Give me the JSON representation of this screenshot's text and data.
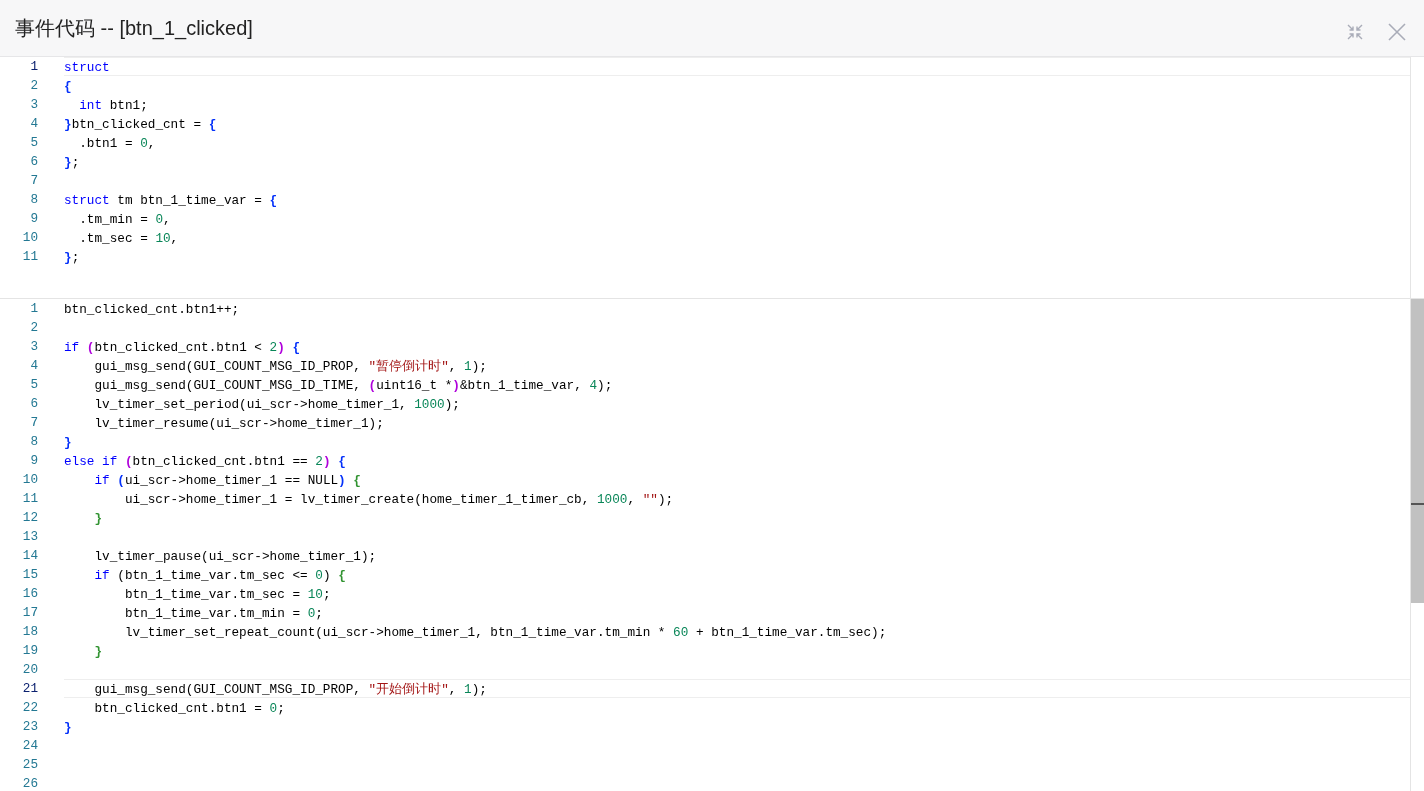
{
  "dialog": {
    "title": "事件代码 -- [btn_1_clicked]"
  },
  "editors": [
    {
      "lines": [
        {
          "num": "1",
          "current": true,
          "tokens": [
            {
              "kind": "keyword",
              "text": "struct"
            }
          ]
        },
        {
          "num": "2",
          "current": false,
          "tokens": [
            {
              "kind": "bracket",
              "text": "{",
              "color": "#0431fa"
            }
          ]
        },
        {
          "num": "3",
          "current": false,
          "tokens": [
            {
              "kind": "keyword",
              "text": "  int"
            },
            {
              "kind": "plain",
              "text": " btn1;"
            }
          ]
        },
        {
          "num": "4",
          "current": false,
          "tokens": [
            {
              "kind": "bracket",
              "text": "}",
              "color": "#0431fa"
            },
            {
              "kind": "plain",
              "text": "btn_clicked_cnt = "
            },
            {
              "kind": "bracket",
              "text": "{",
              "color": "#0431fa"
            }
          ]
        },
        {
          "num": "5",
          "current": false,
          "tokens": [
            {
              "kind": "plain",
              "text": "  .btn1 = "
            },
            {
              "kind": "number",
              "text": "0"
            },
            {
              "kind": "plain",
              "text": ","
            }
          ]
        },
        {
          "num": "6",
          "current": false,
          "tokens": [
            {
              "kind": "bracket",
              "text": "}",
              "color": "#0431fa"
            },
            {
              "kind": "plain",
              "text": ";"
            }
          ]
        },
        {
          "num": "7",
          "current": false
        },
        {
          "num": "8",
          "current": false,
          "tokens": [
            {
              "kind": "keyword",
              "text": "struct"
            },
            {
              "kind": "plain",
              "text": " tm btn_1_time_var = "
            },
            {
              "kind": "bracket",
              "text": "{",
              "color": "#0431fa"
            }
          ]
        },
        {
          "num": "9",
          "current": false,
          "tokens": [
            {
              "kind": "plain",
              "text": "  .tm_min = "
            },
            {
              "kind": "number",
              "text": "0"
            },
            {
              "kind": "plain",
              "text": ","
            }
          ]
        },
        {
          "num": "10",
          "current": false,
          "tokens": [
            {
              "kind": "plain",
              "text": "  .tm_sec = "
            },
            {
              "kind": "number",
              "text": "10"
            },
            {
              "kind": "plain",
              "text": ","
            }
          ]
        },
        {
          "num": "11",
          "current": false,
          "tokens": [
            {
              "kind": "bracket",
              "text": "}",
              "color": "#0431fa"
            },
            {
              "kind": "plain",
              "text": ";"
            }
          ]
        }
      ]
    },
    {
      "lines": [
        {
          "num": "1",
          "current": false,
          "tokens": [
            {
              "kind": "plain",
              "text": "btn_clicked_cnt.btn1++;"
            }
          ]
        },
        {
          "num": "2",
          "current": false
        },
        {
          "num": "3",
          "current": false,
          "tokens": [
            {
              "kind": "keyword",
              "text": "if"
            },
            {
              "kind": "bracket",
              "text": " (",
              "color": "#af00db"
            },
            {
              "kind": "plain",
              "text": "btn_clicked_cnt.btn1 < "
            },
            {
              "kind": "number",
              "text": "2"
            },
            {
              "kind": "bracket",
              "text": ")",
              "color": "#af00db"
            },
            {
              "kind": "bracket",
              "text": " {",
              "color": "#0431fa"
            }
          ]
        },
        {
          "num": "4",
          "current": false,
          "tokens": [
            {
              "kind": "plain",
              "text": "    gui_msg_send(GUI_COUNT_MSG_ID_PROP, "
            },
            {
              "kind": "string",
              "text": "\"暂停倒计时\""
            },
            {
              "kind": "plain",
              "text": ", "
            },
            {
              "kind": "number",
              "text": "1"
            },
            {
              "kind": "plain",
              "text": ");"
            }
          ]
        },
        {
          "num": "5",
          "current": false,
          "tokens": [
            {
              "kind": "plain",
              "text": "    gui_msg_send(GUI_COUNT_MSG_ID_TIME, "
            },
            {
              "kind": "bracket",
              "text": "(",
              "color": "#af00db"
            },
            {
              "kind": "plain",
              "text": "uint16_t *"
            },
            {
              "kind": "bracket",
              "text": ")",
              "color": "#af00db"
            },
            {
              "kind": "plain",
              "text": "&btn_1_time_var, "
            },
            {
              "kind": "number",
              "text": "4"
            },
            {
              "kind": "plain",
              "text": ");"
            }
          ]
        },
        {
          "num": "6",
          "current": false,
          "tokens": [
            {
              "kind": "plain",
              "text": "    lv_timer_set_period(ui_scr->home_timer_1, "
            },
            {
              "kind": "number",
              "text": "1000"
            },
            {
              "kind": "plain",
              "text": ");"
            }
          ]
        },
        {
          "num": "7",
          "current": false,
          "tokens": [
            {
              "kind": "plain",
              "text": "    lv_timer_resume(ui_scr->home_timer_1);"
            }
          ]
        },
        {
          "num": "8",
          "current": false,
          "tokens": [
            {
              "kind": "bracket",
              "text": "}",
              "color": "#0431fa"
            }
          ]
        },
        {
          "num": "9",
          "current": false,
          "tokens": [
            {
              "kind": "keyword",
              "text": "else if"
            },
            {
              "kind": "bracket",
              "text": " (",
              "color": "#af00db"
            },
            {
              "kind": "plain",
              "text": "btn_clicked_cnt.btn1 == "
            },
            {
              "kind": "number",
              "text": "2"
            },
            {
              "kind": "bracket",
              "text": ")",
              "color": "#af00db"
            },
            {
              "kind": "bracket",
              "text": " {",
              "color": "#0431fa"
            }
          ]
        },
        {
          "num": "10",
          "current": false,
          "tokens": [
            {
              "kind": "keyword",
              "text": "    if"
            },
            {
              "kind": "bracket",
              "text": " (",
              "color": "#0431fa"
            },
            {
              "kind": "plain",
              "text": "ui_scr->home_timer_1 == NULL"
            },
            {
              "kind": "bracket",
              "text": ")",
              "color": "#0431fa"
            },
            {
              "kind": "bracket",
              "text": " {",
              "color": "#319331"
            }
          ]
        },
        {
          "num": "11",
          "current": false,
          "tokens": [
            {
              "kind": "plain",
              "text": "        ui_scr->home_timer_1 = lv_timer_create(home_timer_1_timer_cb, "
            },
            {
              "kind": "number",
              "text": "1000"
            },
            {
              "kind": "plain",
              "text": ", "
            },
            {
              "kind": "string",
              "text": "\"\""
            },
            {
              "kind": "plain",
              "text": ");"
            }
          ]
        },
        {
          "num": "12",
          "current": false,
          "tokens": [
            {
              "kind": "bracket",
              "text": "    }",
              "color": "#319331"
            }
          ]
        },
        {
          "num": "13",
          "current": false
        },
        {
          "num": "14",
          "current": false,
          "tokens": [
            {
              "kind": "plain",
              "text": "    lv_timer_pause(ui_scr->home_timer_1);"
            }
          ]
        },
        {
          "num": "15",
          "current": false,
          "tokens": [
            {
              "kind": "keyword",
              "text": "    if"
            },
            {
              "kind": "plain",
              "text": " (btn_1_time_var.tm_sec <= "
            },
            {
              "kind": "number",
              "text": "0"
            },
            {
              "kind": "plain",
              "text": ")"
            },
            {
              "kind": "bracket",
              "text": " {",
              "color": "#319331"
            }
          ]
        },
        {
          "num": "16",
          "current": false,
          "tokens": [
            {
              "kind": "plain",
              "text": "        btn_1_time_var.tm_sec = "
            },
            {
              "kind": "number",
              "text": "10"
            },
            {
              "kind": "plain",
              "text": ";"
            }
          ]
        },
        {
          "num": "17",
          "current": false,
          "tokens": [
            {
              "kind": "plain",
              "text": "        btn_1_time_var.tm_min = "
            },
            {
              "kind": "number",
              "text": "0"
            },
            {
              "kind": "plain",
              "text": ";"
            }
          ]
        },
        {
          "num": "18",
          "current": false,
          "tokens": [
            {
              "kind": "plain",
              "text": "        lv_timer_set_repeat_count(ui_scr->home_timer_1, btn_1_time_var.tm_min * "
            },
            {
              "kind": "number",
              "text": "60"
            },
            {
              "kind": "plain",
              "text": " + btn_1_time_var.tm_sec);"
            }
          ]
        },
        {
          "num": "19",
          "current": false,
          "tokens": [
            {
              "kind": "bracket",
              "text": "    }",
              "color": "#319331"
            }
          ]
        },
        {
          "num": "20",
          "current": false
        },
        {
          "num": "21",
          "current": true,
          "tokens": [
            {
              "kind": "plain",
              "text": "    gui_msg_send(GUI_COUNT_MSG_ID_PROP, "
            },
            {
              "kind": "string",
              "text": "\"开始倒计时\""
            },
            {
              "kind": "plain",
              "text": ", "
            },
            {
              "kind": "number",
              "text": "1"
            },
            {
              "kind": "plain",
              "text": ");"
            }
          ]
        },
        {
          "num": "22",
          "current": false,
          "tokens": [
            {
              "kind": "plain",
              "text": "    btn_clicked_cnt.btn1 = "
            },
            {
              "kind": "number",
              "text": "0"
            },
            {
              "kind": "plain",
              "text": ";"
            }
          ]
        },
        {
          "num": "23",
          "current": false,
          "tokens": [
            {
              "kind": "bracket",
              "text": "}",
              "color": "#0431fa"
            }
          ]
        },
        {
          "num": "24",
          "current": false
        },
        {
          "num": "25",
          "current": false
        },
        {
          "num": "26",
          "current": false
        }
      ]
    }
  ]
}
